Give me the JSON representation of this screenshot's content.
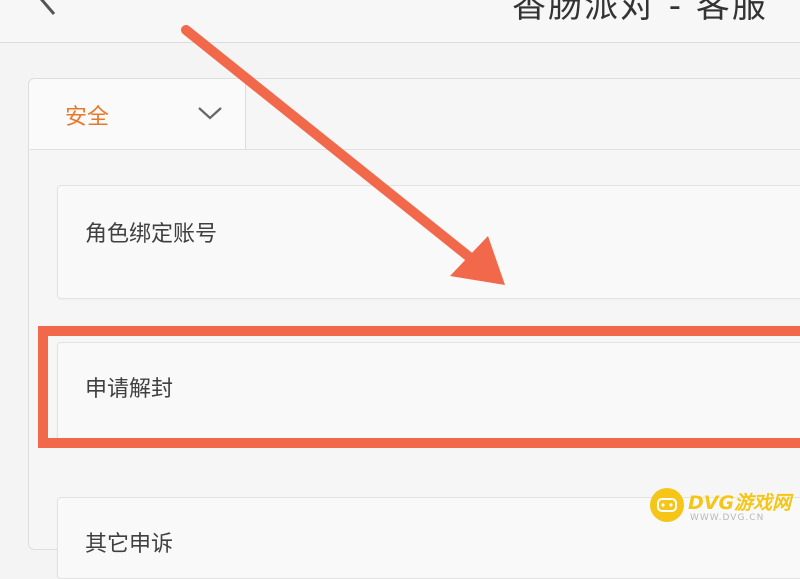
{
  "header": {
    "title": "香肠派对 - 客服"
  },
  "category": {
    "selected": "安全"
  },
  "list": {
    "items": [
      {
        "label": "角色绑定账号"
      },
      {
        "label": "申请解封"
      },
      {
        "label": "其它申诉"
      }
    ]
  },
  "annotation": {
    "color": "#f2684a",
    "highlighted_item": "申请解封"
  },
  "watermark": {
    "brand": "DVG游戏网",
    "domain": "WWW.DVG.CN",
    "color": "#f5c518"
  },
  "colors": {
    "accent": "#e8782a",
    "annotation": "#f2684a"
  }
}
